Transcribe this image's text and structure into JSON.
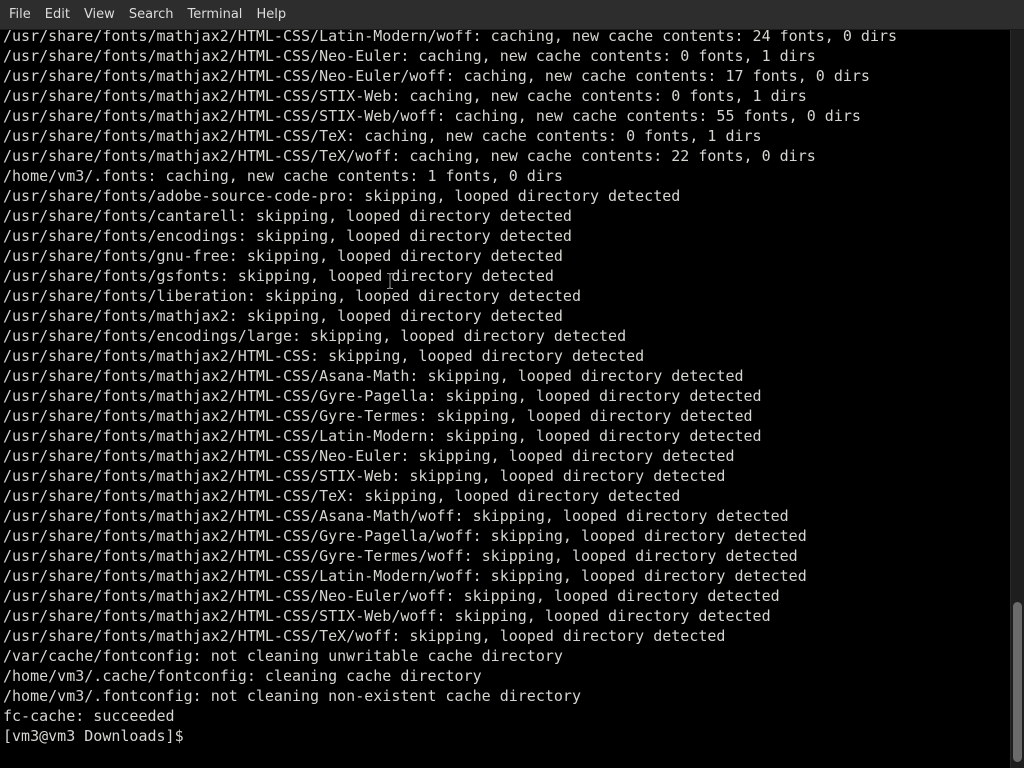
{
  "menubar": {
    "items": [
      "File",
      "Edit",
      "View",
      "Search",
      "Terminal",
      "Help"
    ]
  },
  "terminal": {
    "lines": [
      "/usr/share/fonts/mathjax2/HTML-CSS/Latin-Modern/woff: caching, new cache contents: 24 fonts, 0 dirs",
      "/usr/share/fonts/mathjax2/HTML-CSS/Neo-Euler: caching, new cache contents: 0 fonts, 1 dirs",
      "/usr/share/fonts/mathjax2/HTML-CSS/Neo-Euler/woff: caching, new cache contents: 17 fonts, 0 dirs",
      "/usr/share/fonts/mathjax2/HTML-CSS/STIX-Web: caching, new cache contents: 0 fonts, 1 dirs",
      "/usr/share/fonts/mathjax2/HTML-CSS/STIX-Web/woff: caching, new cache contents: 55 fonts, 0 dirs",
      "/usr/share/fonts/mathjax2/HTML-CSS/TeX: caching, new cache contents: 0 fonts, 1 dirs",
      "/usr/share/fonts/mathjax2/HTML-CSS/TeX/woff: caching, new cache contents: 22 fonts, 0 dirs",
      "/home/vm3/.fonts: caching, new cache contents: 1 fonts, 0 dirs",
      "/usr/share/fonts/adobe-source-code-pro: skipping, looped directory detected",
      "/usr/share/fonts/cantarell: skipping, looped directory detected",
      "/usr/share/fonts/encodings: skipping, looped directory detected",
      "/usr/share/fonts/gnu-free: skipping, looped directory detected",
      "/usr/share/fonts/gsfonts: skipping, looped directory detected",
      "/usr/share/fonts/liberation: skipping, looped directory detected",
      "/usr/share/fonts/mathjax2: skipping, looped directory detected",
      "/usr/share/fonts/encodings/large: skipping, looped directory detected",
      "/usr/share/fonts/mathjax2/HTML-CSS: skipping, looped directory detected",
      "/usr/share/fonts/mathjax2/HTML-CSS/Asana-Math: skipping, looped directory detected",
      "/usr/share/fonts/mathjax2/HTML-CSS/Gyre-Pagella: skipping, looped directory detected",
      "/usr/share/fonts/mathjax2/HTML-CSS/Gyre-Termes: skipping, looped directory detected",
      "/usr/share/fonts/mathjax2/HTML-CSS/Latin-Modern: skipping, looped directory detected",
      "/usr/share/fonts/mathjax2/HTML-CSS/Neo-Euler: skipping, looped directory detected",
      "/usr/share/fonts/mathjax2/HTML-CSS/STIX-Web: skipping, looped directory detected",
      "/usr/share/fonts/mathjax2/HTML-CSS/TeX: skipping, looped directory detected",
      "/usr/share/fonts/mathjax2/HTML-CSS/Asana-Math/woff: skipping, looped directory detected",
      "/usr/share/fonts/mathjax2/HTML-CSS/Gyre-Pagella/woff: skipping, looped directory detected",
      "/usr/share/fonts/mathjax2/HTML-CSS/Gyre-Termes/woff: skipping, looped directory detected",
      "/usr/share/fonts/mathjax2/HTML-CSS/Latin-Modern/woff: skipping, looped directory detected",
      "/usr/share/fonts/mathjax2/HTML-CSS/Neo-Euler/woff: skipping, looped directory detected",
      "/usr/share/fonts/mathjax2/HTML-CSS/STIX-Web/woff: skipping, looped directory detected",
      "/usr/share/fonts/mathjax2/HTML-CSS/TeX/woff: skipping, looped directory detected",
      "/var/cache/fontconfig: not cleaning unwritable cache directory",
      "/home/vm3/.cache/fontconfig: cleaning cache directory",
      "/home/vm3/.fontconfig: not cleaning non-existent cache directory",
      "fc-cache: succeeded"
    ],
    "prompt": "[vm3@vm3 Downloads]$ "
  },
  "colors": {
    "background": "#000000",
    "foreground": "#d3d7cf",
    "menubar": "#2d2d2d",
    "scrollbar_thumb": "#6b6b6b"
  }
}
